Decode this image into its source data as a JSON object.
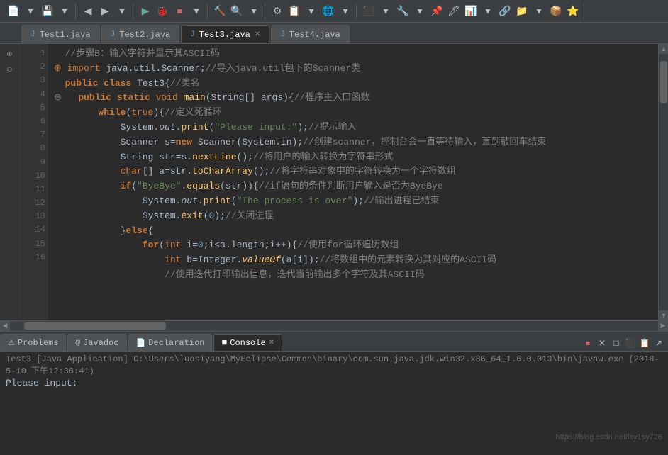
{
  "toolbar": {
    "buttons": [
      "⬛",
      "💾",
      "🖨",
      "▶",
      "⏹",
      "⚙",
      "🔍",
      "📋",
      "✂",
      "📌"
    ]
  },
  "tabs": {
    "items": [
      {
        "id": "tab1",
        "label": "Test1.java",
        "active": false
      },
      {
        "id": "tab2",
        "label": "Test2.java",
        "active": false
      },
      {
        "id": "tab3",
        "label": "Test3.java",
        "active": true,
        "modified": true
      },
      {
        "id": "tab4",
        "label": "Test4.java",
        "active": false
      }
    ]
  },
  "editor": {
    "lines": [
      "  //步骤B：输入字符并显示其ASCII码",
      "⊕ import java.util.Scanner;//导入java.util包下的Scanner类",
      "  public class Test3{//类名",
      "⊖   public static void main(String[] args){//程序主入口函数",
      "        while(true){//定义死循环",
      "            System.out.print(\"Please input:\");//提示输入",
      "            Scanner s=new Scanner(System.in);//创建scanner，控制台会一直等待输入，直到敲回车结束",
      "            String str=s.nextLine();//将用户的输入转换为字符串形式",
      "            char[] a=str.toCharArray();//将字符串对象中的字符转换为一个字符数组",
      "            if(\"ByeBye\".equals(str)){//if语句的条件判断用户输入是否为ByeBye",
      "                System.out.print(\"The process is over\");//输出进程已结束",
      "                System.exit(0);//关闭进程",
      "            }else{",
      "                for(int i=0;i<a.length;i++){//使用for循环遍历数组",
      "                    int b=Integer.valueOf(a[i]);//将数组中的元素转换为其对应的ASCII码",
      "                    //使用迭代打印输出信息，迭代当前输出多个字符及其ASCII码"
    ]
  },
  "bottom_tabs": {
    "items": [
      {
        "id": "problems",
        "label": "Problems",
        "icon": "⚠"
      },
      {
        "id": "javadoc",
        "label": "Javadoc",
        "icon": "@"
      },
      {
        "id": "declaration",
        "label": "Declaration",
        "icon": "📄"
      },
      {
        "id": "console",
        "label": "Console",
        "icon": ">",
        "active": true
      }
    ]
  },
  "console": {
    "path_label": "Test3 [Java Application] C:\\Users\\luosiyang\\MyEclipse\\Common\\binary\\com.sun.java.jdk.win32.x86_64_1.6.0.013\\bin\\javaw.exe (2018-5-10 下午12:36:41)",
    "output": "Please input:"
  },
  "watermark": "https://blog.csdn.net/lsy1sy726"
}
